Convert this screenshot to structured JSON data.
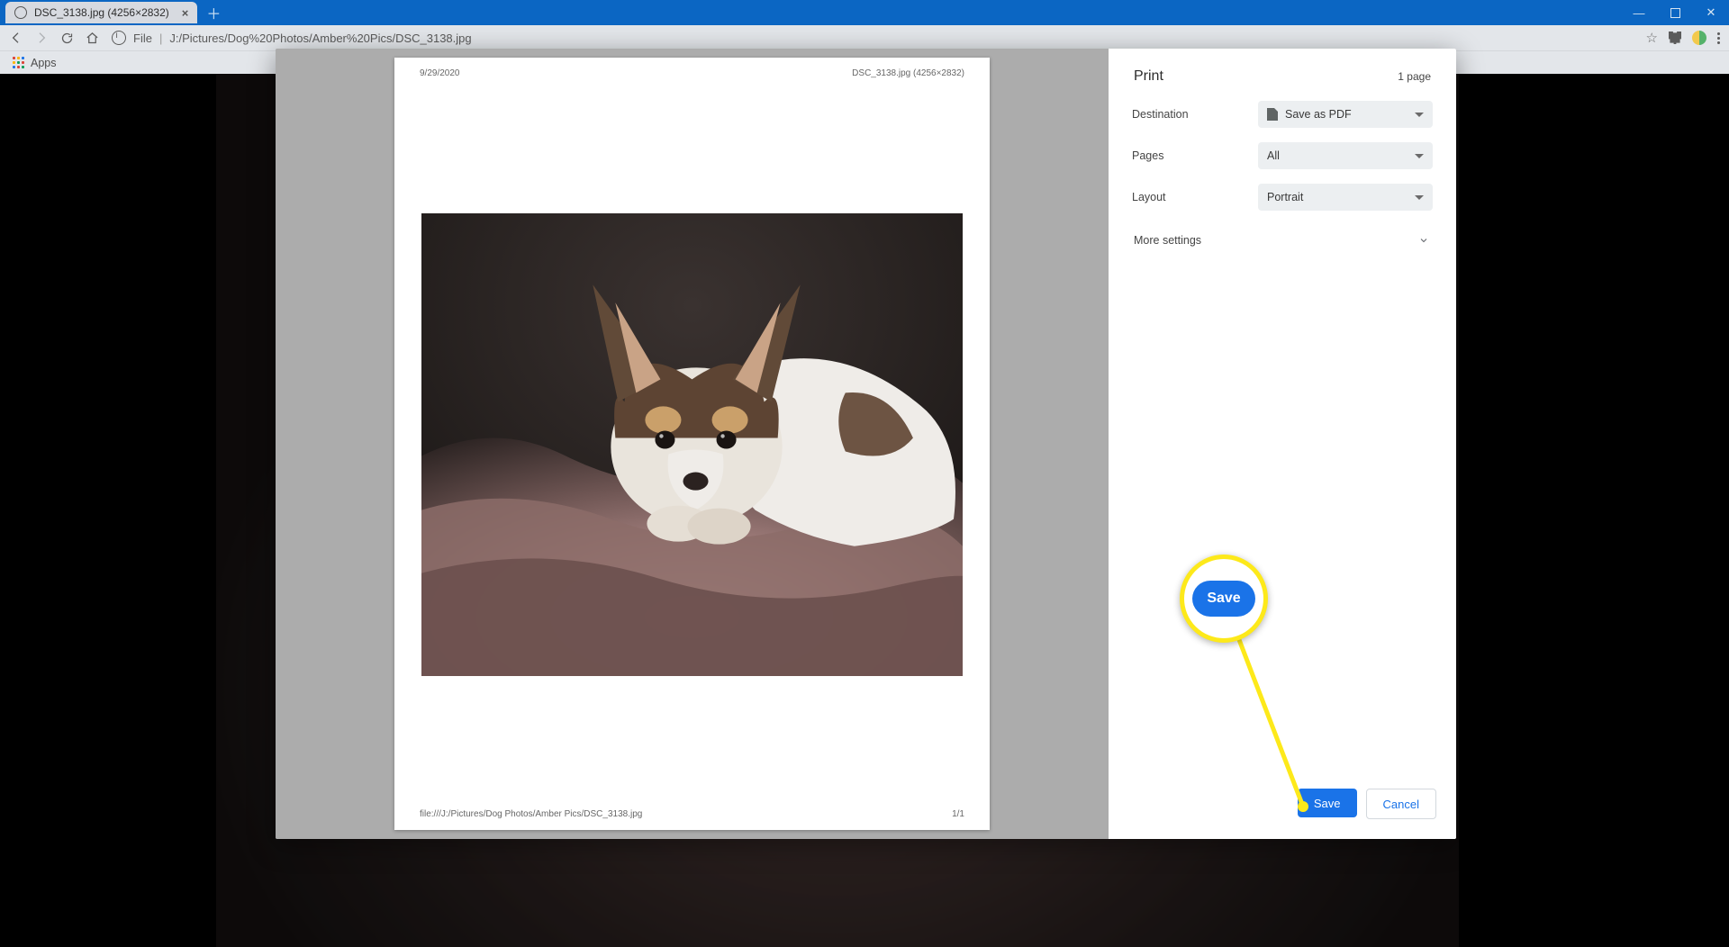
{
  "tab": {
    "title": "DSC_3138.jpg (4256×2832)"
  },
  "url": {
    "scheme": "File",
    "path": "J:/Pictures/Dog%20Photos/Amber%20Pics/DSC_3138.jpg"
  },
  "bookmarks": {
    "apps": "Apps"
  },
  "preview": {
    "date": "9/29/2020",
    "title": "DSC_3138.jpg (4256×2832)",
    "footer_path": "file:///J:/Pictures/Dog Photos/Amber Pics/DSC_3138.jpg",
    "footer_page": "1/1"
  },
  "print": {
    "title": "Print",
    "page_count": "1 page",
    "rows": {
      "destination": {
        "label": "Destination",
        "value": "Save as PDF"
      },
      "pages": {
        "label": "Pages",
        "value": "All"
      },
      "layout": {
        "label": "Layout",
        "value": "Portrait"
      }
    },
    "more_settings": "More settings",
    "save": "Save",
    "cancel": "Cancel"
  },
  "annotation": {
    "save_callout": "Save"
  }
}
